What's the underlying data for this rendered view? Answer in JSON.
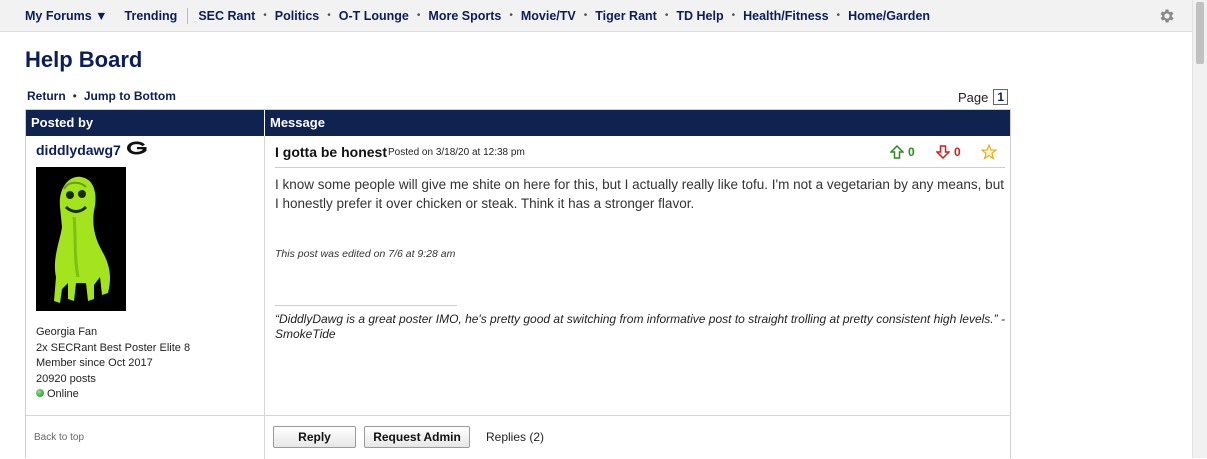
{
  "nav": {
    "my_forums": "My Forums ▼",
    "trending": "Trending",
    "items": [
      "SEC Rant",
      "Politics",
      "O-T Lounge",
      "More Sports",
      "Movie/TV",
      "Tiger Rant",
      "TD Help",
      "Health/Fitness",
      "Home/Garden"
    ],
    "settings_icon": "gear-icon"
  },
  "board": {
    "title": "Help Board",
    "return_label": "Return",
    "jump_label": "Jump to Bottom",
    "page_label": "Page",
    "page_number": "1"
  },
  "table": {
    "col_posted_by": "Posted by",
    "col_message": "Message"
  },
  "post": {
    "username": "diddlydawg7",
    "team_logo": "G",
    "user_meta": [
      "Georgia Fan",
      "2x SECRant Best Poster Elite 8",
      "Member since Oct 2017",
      "20920 posts"
    ],
    "online_label": "Online",
    "title": "I gotta be honest",
    "posted_on": "Posted on 3/18/20 at 12:38 pm",
    "upvotes": "0",
    "downvotes": "0",
    "body": "I know some people will give me shite on here for this, but I actually really like tofu. I'm not a vegetarian by any means, but I honestly prefer it over chicken or steak. Think it has a stronger flavor.",
    "edited": "This post was edited on 7/6 at 9:28 am",
    "signature": "“DiddlyDawg is a great poster IMO, he's pretty good at switching from informative post to straight trolling at pretty consistent high levels.” - SmokeTide"
  },
  "footer": {
    "back_to_top": "Back to top",
    "reply_label": "Reply",
    "request_admin_label": "Request Admin",
    "replies_label": "Replies (2)"
  },
  "colors": {
    "header_bg": "#10224f",
    "link": "#0c1e58",
    "upvote": "#2a8a1e",
    "downvote": "#cc1f1f"
  }
}
